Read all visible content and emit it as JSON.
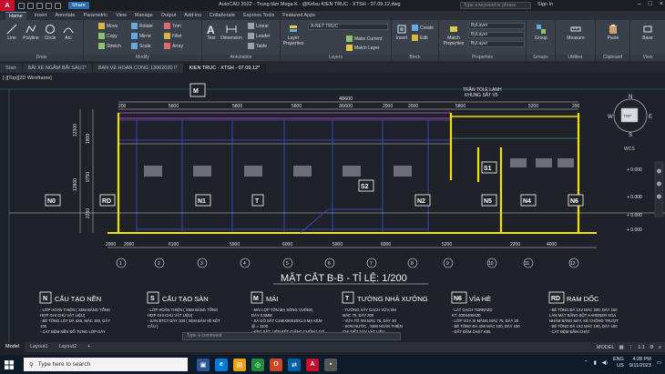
{
  "titlebar": {
    "logo": "A",
    "share": "Share",
    "title": "AutoCAD 2022 - Trung tâm Mega K - @Kelsu KIEN TRUC - XTSH - 07.09.12.dwg",
    "search_placeholder": "Type a keyword or phrase",
    "signin": "Sign In"
  },
  "ribbon_tabs": [
    "Home",
    "Insert",
    "Annotate",
    "Parametric",
    "View",
    "Manage",
    "Output",
    "Add-ins",
    "Collaborate",
    "Express Tools",
    "Featured Apps"
  ],
  "ribbon": {
    "draw": {
      "label": "Draw",
      "line": "Line",
      "polyline": "Polyline",
      "circle": "Circle",
      "arc": "Arc"
    },
    "modify": {
      "label": "Modify",
      "move": "Move",
      "rotate": "Rotate",
      "trim": "Trim",
      "copy": "Copy",
      "mirror": "Mirror",
      "fillet": "Fillet",
      "stretch": "Stretch",
      "scale": "Scale",
      "array": "Array"
    },
    "annotation": {
      "label": "Annotation",
      "text": "Text",
      "dimension": "Dimension",
      "linear": "Linear",
      "leader": "Leader",
      "table": "Table"
    },
    "layers": {
      "label": "Layers",
      "properties": "Layer Properties",
      "current_layer": "A-NET TRUC",
      "make_current": "Make Current",
      "match_layer": "Match Layer"
    },
    "block": {
      "label": "Block",
      "insert": "Insert",
      "create": "Create",
      "edit": "Edit"
    },
    "properties": {
      "label": "Properties",
      "match": "Match Properties",
      "bylayer1": "ByLayer",
      "bylayer2": "ByLayer",
      "bylayer3": "ByLayer"
    },
    "groups": {
      "label": "Groups",
      "group": "Group"
    },
    "utilities": {
      "label": "Utilities",
      "measure": "Measure"
    },
    "clipboard": {
      "label": "Clipboard",
      "paste": "Paste"
    },
    "view": {
      "label": "View",
      "base": "Base"
    }
  },
  "file_tabs": [
    "Start",
    "BẢI XE NGẦM BÃI SAU1*",
    "BAN VE HOAN CONG 13062020 I*",
    "KIEN TRUC - XTSH - 07.09.12*"
  ],
  "viewport": {
    "label": "[-][Top][2D Wireframe]",
    "compass": {
      "n": "N",
      "s": "S",
      "e": "E",
      "w": "W",
      "top": "TOP",
      "wcs": "WCS"
    }
  },
  "drawing": {
    "section_title": "MẶT CẮT B-B - TỈ LỆ: 1/200",
    "total_dim": "48600",
    "inner_dim": "36600",
    "top_dims": [
      "200",
      "5800",
      "5800",
      "5800",
      "2000",
      "2000",
      "5800",
      "5200",
      "200"
    ],
    "bottom_dims": [
      "2000",
      "2000",
      "6100",
      "5900",
      "6000",
      "5900",
      "6000",
      "5200",
      "2200",
      "4000"
    ],
    "axis_markers": [
      "N0",
      "RD",
      "N1",
      "T",
      "S2",
      "N2",
      "S1",
      "N5",
      "N4",
      "N6",
      "M"
    ],
    "grid_bubbles": [
      "1",
      "2",
      "3",
      "4",
      "5",
      "6",
      "7",
      "8",
      "9",
      "10",
      "11",
      "12"
    ],
    "roof_note_1": "TRẦN TOLE LẠNH",
    "roof_note_2": "KHUNG SẮT V5",
    "left_levels": [
      "1800",
      "12300",
      "9750",
      "2250",
      "12800"
    ],
    "right_levels": [
      "+ 0.000",
      "+ 0.000",
      "+ 0.000",
      "+ 0.000"
    ],
    "legend": [
      {
        "code": "N",
        "title": "CẤU TẠO NỀN",
        "lines": [
          "- LỚP HOÀN THIỆN ( XEM BẢNG TỔNG",
          "HỢP GHI CHÚ VẬT LIỆU)",
          "- BÊ TÔNG LÓT ĐÁ 4X6, MÁC 150, DÀY",
          "100",
          "- CÁT ĐỆM NỀN ĐỔ TỪNG LỚP DÀY"
        ]
      },
      {
        "code": "S",
        "title": "CẤU TẠO SÀN",
        "lines": [
          "- LỚP HOÀN THIỆN ( XEM BẢNG TỔNG",
          "HỢP GHI CHÚ VẬT LIỆU)",
          "- SÀN BTCT DÀY 100 ( XEM BẢN VẼ KẾT",
          "CẤU )"
        ]
      },
      {
        "code": "M",
        "title": "MÁI",
        "lines": [
          "- MÁI LỢP TÔN MẠ SÓNG VUÔNG,",
          "DÀY 0.5MM",
          "- XÀ GỒ SẮT C150X50X20X1.8 MẠ KẼM",
          "@ = 1100",
          "- KÈO SẮT, LIÊN KẾT GIẰNG CHỐNG GÓ"
        ]
      },
      {
        "code": "T",
        "title": "TƯỜNG NHÀ XƯỞNG",
        "lines": [
          "- TƯỜNG XÂY GẠCH VỮA XM",
          "MÁC 75, DÀY 200",
          "- VỮA TÔ XM MÁC 75, DÀY 20",
          "- SƠN NƯỚC , XEM HOÀN THIỆN",
          "CHI TIẾT TÙY VẬT LIỆU"
        ]
      },
      {
        "code": "N6",
        "title": "VỈA HÈ",
        "lines": [
          "- LÁT GẠCH TERRAZO",
          "KT: 400X400X30",
          "- LỚP VỮA XI MĂNG MÁC 75, DÀY 20",
          "- BÊ TÔNG ĐÁ 4X6 MÁC 100, DÀY 100",
          "- ĐẤT ĐẦM CHẶT K95"
        ]
      },
      {
        "code": "RD",
        "title": "RAM DỐC",
        "lines": [
          "- BÊ TÔNG ĐÁ 1X2 MÁC 300, DÀY 150",
          "LÀM MẶT BẰNG BỘT HARDNER XOA",
          "NHÁM BẰNG MÁY, KẺ CHỐNG TRƯỢT",
          "- BÊ TÔNG ĐÁ 1X2 MÁC 100, DÀY 100",
          "- CÁT ĐỆM ĐẦM CHẶT"
        ]
      }
    ]
  },
  "cmdline_placeholder": "Type a command",
  "layout_tabs": [
    "Model",
    "Layout1",
    "Layout2",
    "+"
  ],
  "status": {
    "model": "MODEL",
    "scale": "1:1"
  },
  "taskbar": {
    "search_placeholder": "Type here to search",
    "lang": "ENG",
    "region": "US",
    "time": "4:28 PM",
    "date": "9/11/2023"
  },
  "colors": {
    "ribbon": "#3b414a",
    "canvas": "#1f2329",
    "yellow": "#f2e200",
    "cyan": "#3fd8e8",
    "magenta": "#d04fd0",
    "blue": "#3d4fd8"
  }
}
